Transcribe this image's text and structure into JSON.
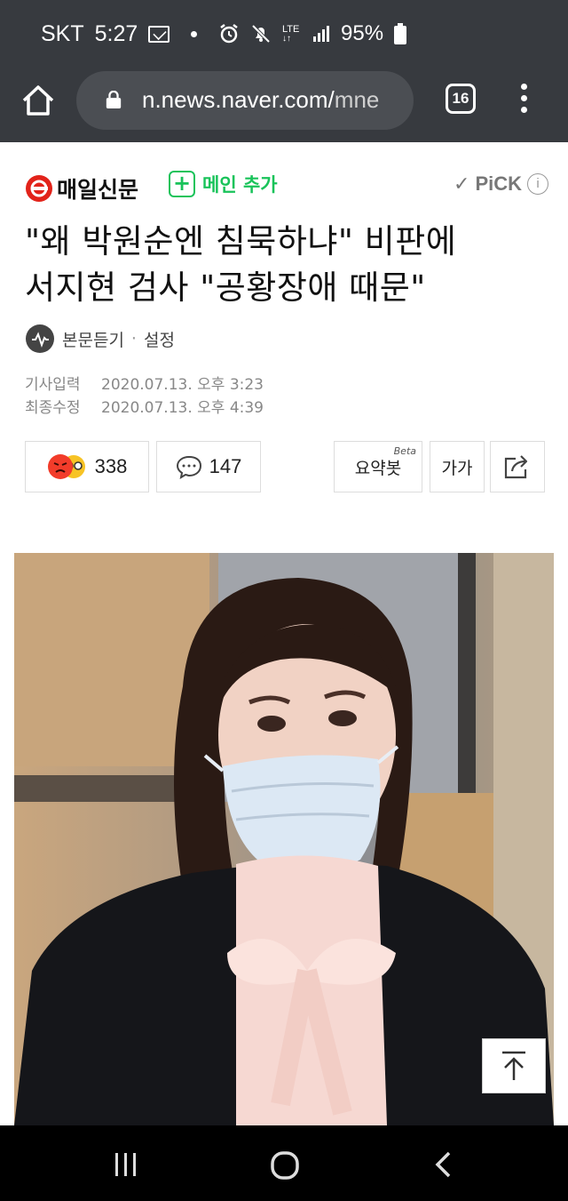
{
  "status_bar": {
    "carrier": "SKT",
    "time": "5:27",
    "network": "LTE",
    "battery": "95%"
  },
  "browser": {
    "url_visible": "n.news.naver.com/",
    "url_faded": "mne",
    "tab_count": "16"
  },
  "article": {
    "press_name": "매일신문",
    "main_add_label": "메인 추가",
    "pick_label": "PiCK",
    "headline_line1": "\"왜 박원순엔 침묵하냐\" 비판에",
    "headline_line2": "서지현 검사 \"공황장애 때문\"",
    "listen_label": "본문듣기",
    "listen_separator": "·",
    "settings_label": "설정",
    "input_date_label": "기사입력",
    "input_date": "2020.07.13. 오후 3:23",
    "edit_date_label": "최종수정",
    "edit_date": "2020.07.13. 오후 4:39",
    "reaction_count": "338",
    "comment_count": "147",
    "summary_label": "요약봇",
    "summary_badge": "Beta",
    "font_label": "가가"
  },
  "colors": {
    "browser_chrome": "#373a3f",
    "press_red": "#e2231a",
    "naver_green": "#19c35a"
  }
}
